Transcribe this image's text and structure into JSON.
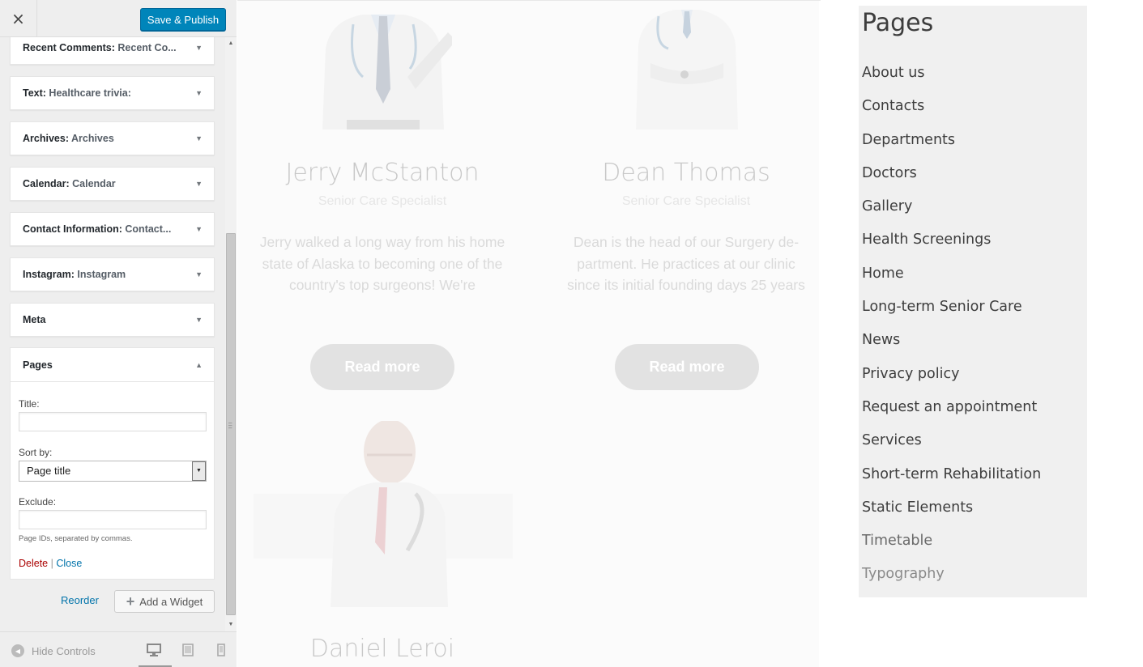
{
  "header": {
    "close_icon": "×",
    "save_label": "Save & Publish"
  },
  "widgets": [
    {
      "type": "Recent Comments",
      "title": "Recent Co..."
    },
    {
      "type": "Text",
      "title": "Healthcare trivia:"
    },
    {
      "type": "Archives",
      "title": "Archives"
    },
    {
      "type": "Calendar",
      "title": "Calendar"
    },
    {
      "type": "Contact Information",
      "title": "Contact..."
    },
    {
      "type": "Instagram",
      "title": "Instagram"
    },
    {
      "type": "Meta",
      "title": ""
    }
  ],
  "pages_widget": {
    "type": "Pages",
    "title_label": "Title:",
    "title_value": "",
    "sort_label": "Sort by:",
    "sort_value": "Page title",
    "exclude_label": "Exclude:",
    "exclude_value": "",
    "exclude_desc": "Page IDs, separated by commas.",
    "delete_label": "Delete",
    "separator": "|",
    "close_label": "Close"
  },
  "actions": {
    "reorder_label": "Reorder",
    "add_widget_label": "Add a Widget"
  },
  "footer": {
    "hide_controls_label": "Hide Controls"
  },
  "preview": {
    "doctors": [
      {
        "name": "Jerry McStanton",
        "role": "Senior Care Specialist",
        "bio": "Jerry walked a long way from his home state of Alaska to becoming one of the country's top surgeons! We're",
        "button": "Read more"
      },
      {
        "name": "Dean Thomas",
        "role": "Senior Care Specialist",
        "bio": "Dean is the head of our Surgery de-partment. He practices at our clinic since its initial founding days 25 years",
        "button": "Read more"
      },
      {
        "name": "Daniel Leroi"
      }
    ],
    "pages_heading": "Pages",
    "pages": [
      "About us",
      "Contacts",
      "Departments",
      "Doctors",
      "Gallery",
      "Health Screenings",
      "Home",
      "Long-term Senior Care",
      "News",
      "Privacy policy",
      "Request an appointment",
      "Services",
      "Short-term Rehabilitation",
      "Static Elements",
      "Timetable",
      "Typography"
    ]
  }
}
